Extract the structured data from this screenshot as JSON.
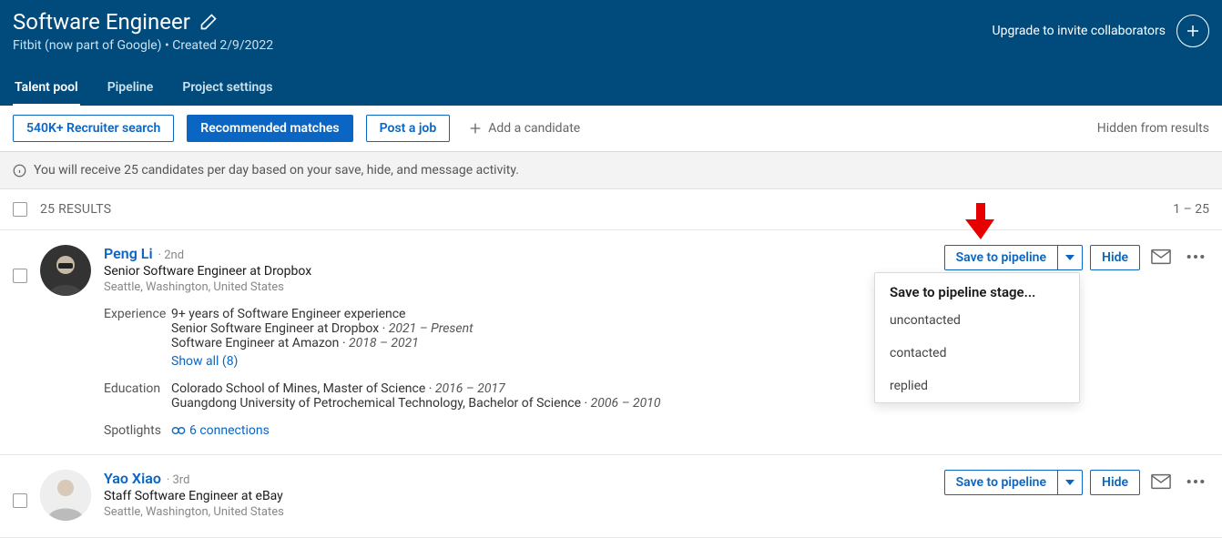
{
  "header": {
    "title": "Software Engineer",
    "subtitle": "Fitbit (now part of Google) • Created 2/9/2022",
    "upgrade": "Upgrade to invite collaborators"
  },
  "tabs": {
    "talent_pool": "Talent pool",
    "pipeline": "Pipeline",
    "project_settings": "Project settings"
  },
  "toolbar": {
    "recruiter_search": "540K+ Recruiter search",
    "recommended": "Recommended matches",
    "post_job": "Post a job",
    "add_candidate": "Add a candidate",
    "hidden": "Hidden from results"
  },
  "banner": "You will receive 25 candidates per day based on your save, hide, and message activity.",
  "results": {
    "count": "25 RESULTS",
    "range": "1 – 25"
  },
  "actions": {
    "save_pipeline": "Save to pipeline",
    "hide": "Hide"
  },
  "dropdown": {
    "title": "Save to pipeline stage...",
    "opt1": "uncontacted",
    "opt2": "contacted",
    "opt3": "replied"
  },
  "card1": {
    "name": "Peng Li",
    "degree": "· 2nd",
    "headline": "Senior Software Engineer at Dropbox",
    "location": "Seattle, Washington, United States",
    "exp_label": "Experience",
    "exp1": "9+ years of Software Engineer experience",
    "exp2_a": "Senior Software Engineer at Dropbox · ",
    "exp2_b": "2021 – Present",
    "exp3_a": "Software Engineer at Amazon · ",
    "exp3_b": "2018 – 2021",
    "show_all": "Show all (8)",
    "edu_label": "Education",
    "edu1_a": "Colorado School of Mines, Master of Science · ",
    "edu1_b": "2016 – 2017",
    "edu2_a": "Guangdong University of Petrochemical Technology, Bachelor of Science · ",
    "edu2_b": "2006 – 2010",
    "spot_label": "Spotlights",
    "connections": "6 connections"
  },
  "card2": {
    "name": "Yao Xiao",
    "degree": "· 3rd",
    "headline": "Staff Software Engineer at eBay",
    "location": "Seattle, Washington, United States"
  }
}
